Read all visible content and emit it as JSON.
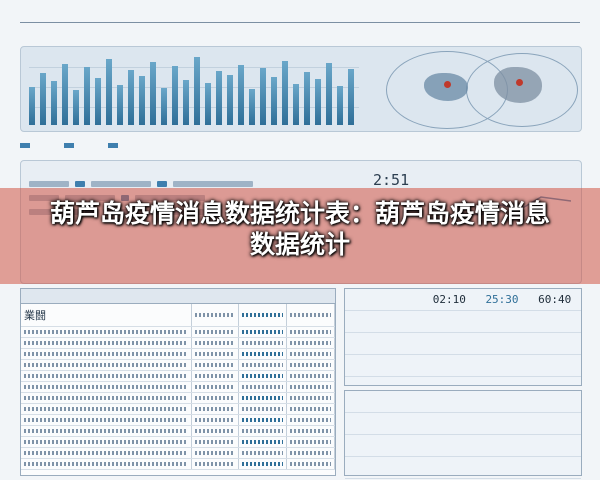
{
  "overlay": {
    "caption": "葫芦岛疫情消息数据统计表：葫芦岛疫情消息数据统计"
  },
  "colors": {
    "overlay_band": "#d25646",
    "bar_blue": "#2f6f98",
    "panel_bg": "#dce6ef",
    "pin_red": "#c0392b"
  },
  "middle": {
    "stat": "2:51"
  },
  "table": {
    "first_cell": "業闘"
  },
  "stats": {
    "top_rows": [
      {
        "label": "",
        "v1": "02:10",
        "v2": "25:30",
        "v3": "60:40"
      },
      {
        "label": "",
        "v1": "",
        "v2": "",
        "v3": ""
      },
      {
        "label": "",
        "v1": "",
        "v2": "",
        "v3": ""
      },
      {
        "label": "",
        "v1": "",
        "v2": "",
        "v3": ""
      }
    ],
    "bottom_rows": [
      {
        "label": "",
        "v1": "",
        "v2": "",
        "v3": ""
      },
      {
        "label": "",
        "v1": "",
        "v2": "",
        "v3": ""
      },
      {
        "label": "",
        "v1": "",
        "v2": "",
        "v3": ""
      },
      {
        "label": "",
        "v1": "",
        "v2": "",
        "v3": ""
      }
    ]
  },
  "icons": {
    "map": "map-icon",
    "pin": "location-pin-icon"
  }
}
